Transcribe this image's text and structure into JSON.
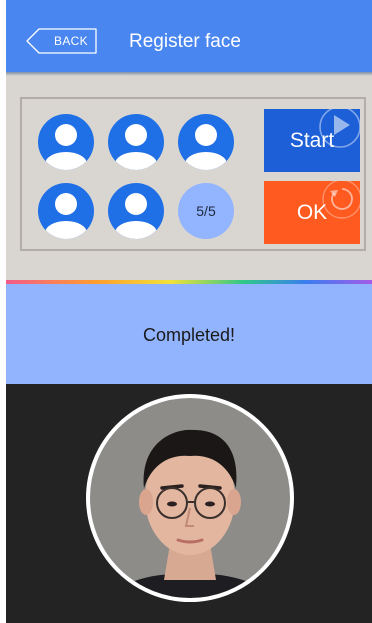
{
  "header": {
    "back_label": "BACK",
    "title": "Register face"
  },
  "capture": {
    "slots": [
      {
        "icon": "person-icon",
        "state": "captured"
      },
      {
        "icon": "person-icon",
        "state": "captured"
      },
      {
        "icon": "person-icon",
        "state": "captured"
      },
      {
        "icon": "person-icon",
        "state": "captured"
      },
      {
        "icon": "person-icon",
        "state": "captured"
      }
    ],
    "count_label": "5/5",
    "captured": 5,
    "total": 5
  },
  "actions": {
    "start_label": "Start",
    "start_icon": "play-icon",
    "ok_label": "OK",
    "ok_icon": "refresh-icon"
  },
  "status": {
    "message": "Completed!"
  },
  "camera": {
    "frame": "face-preview-circle"
  },
  "colors": {
    "header": "#4a86f0",
    "panel": "#d9d6d1",
    "slot": "#1f6fe6",
    "count_slot": "#93b4ff",
    "start": "#1c5fd6",
    "ok": "#ff5a1f",
    "status": "#92b3fe",
    "preview": "#232323"
  }
}
